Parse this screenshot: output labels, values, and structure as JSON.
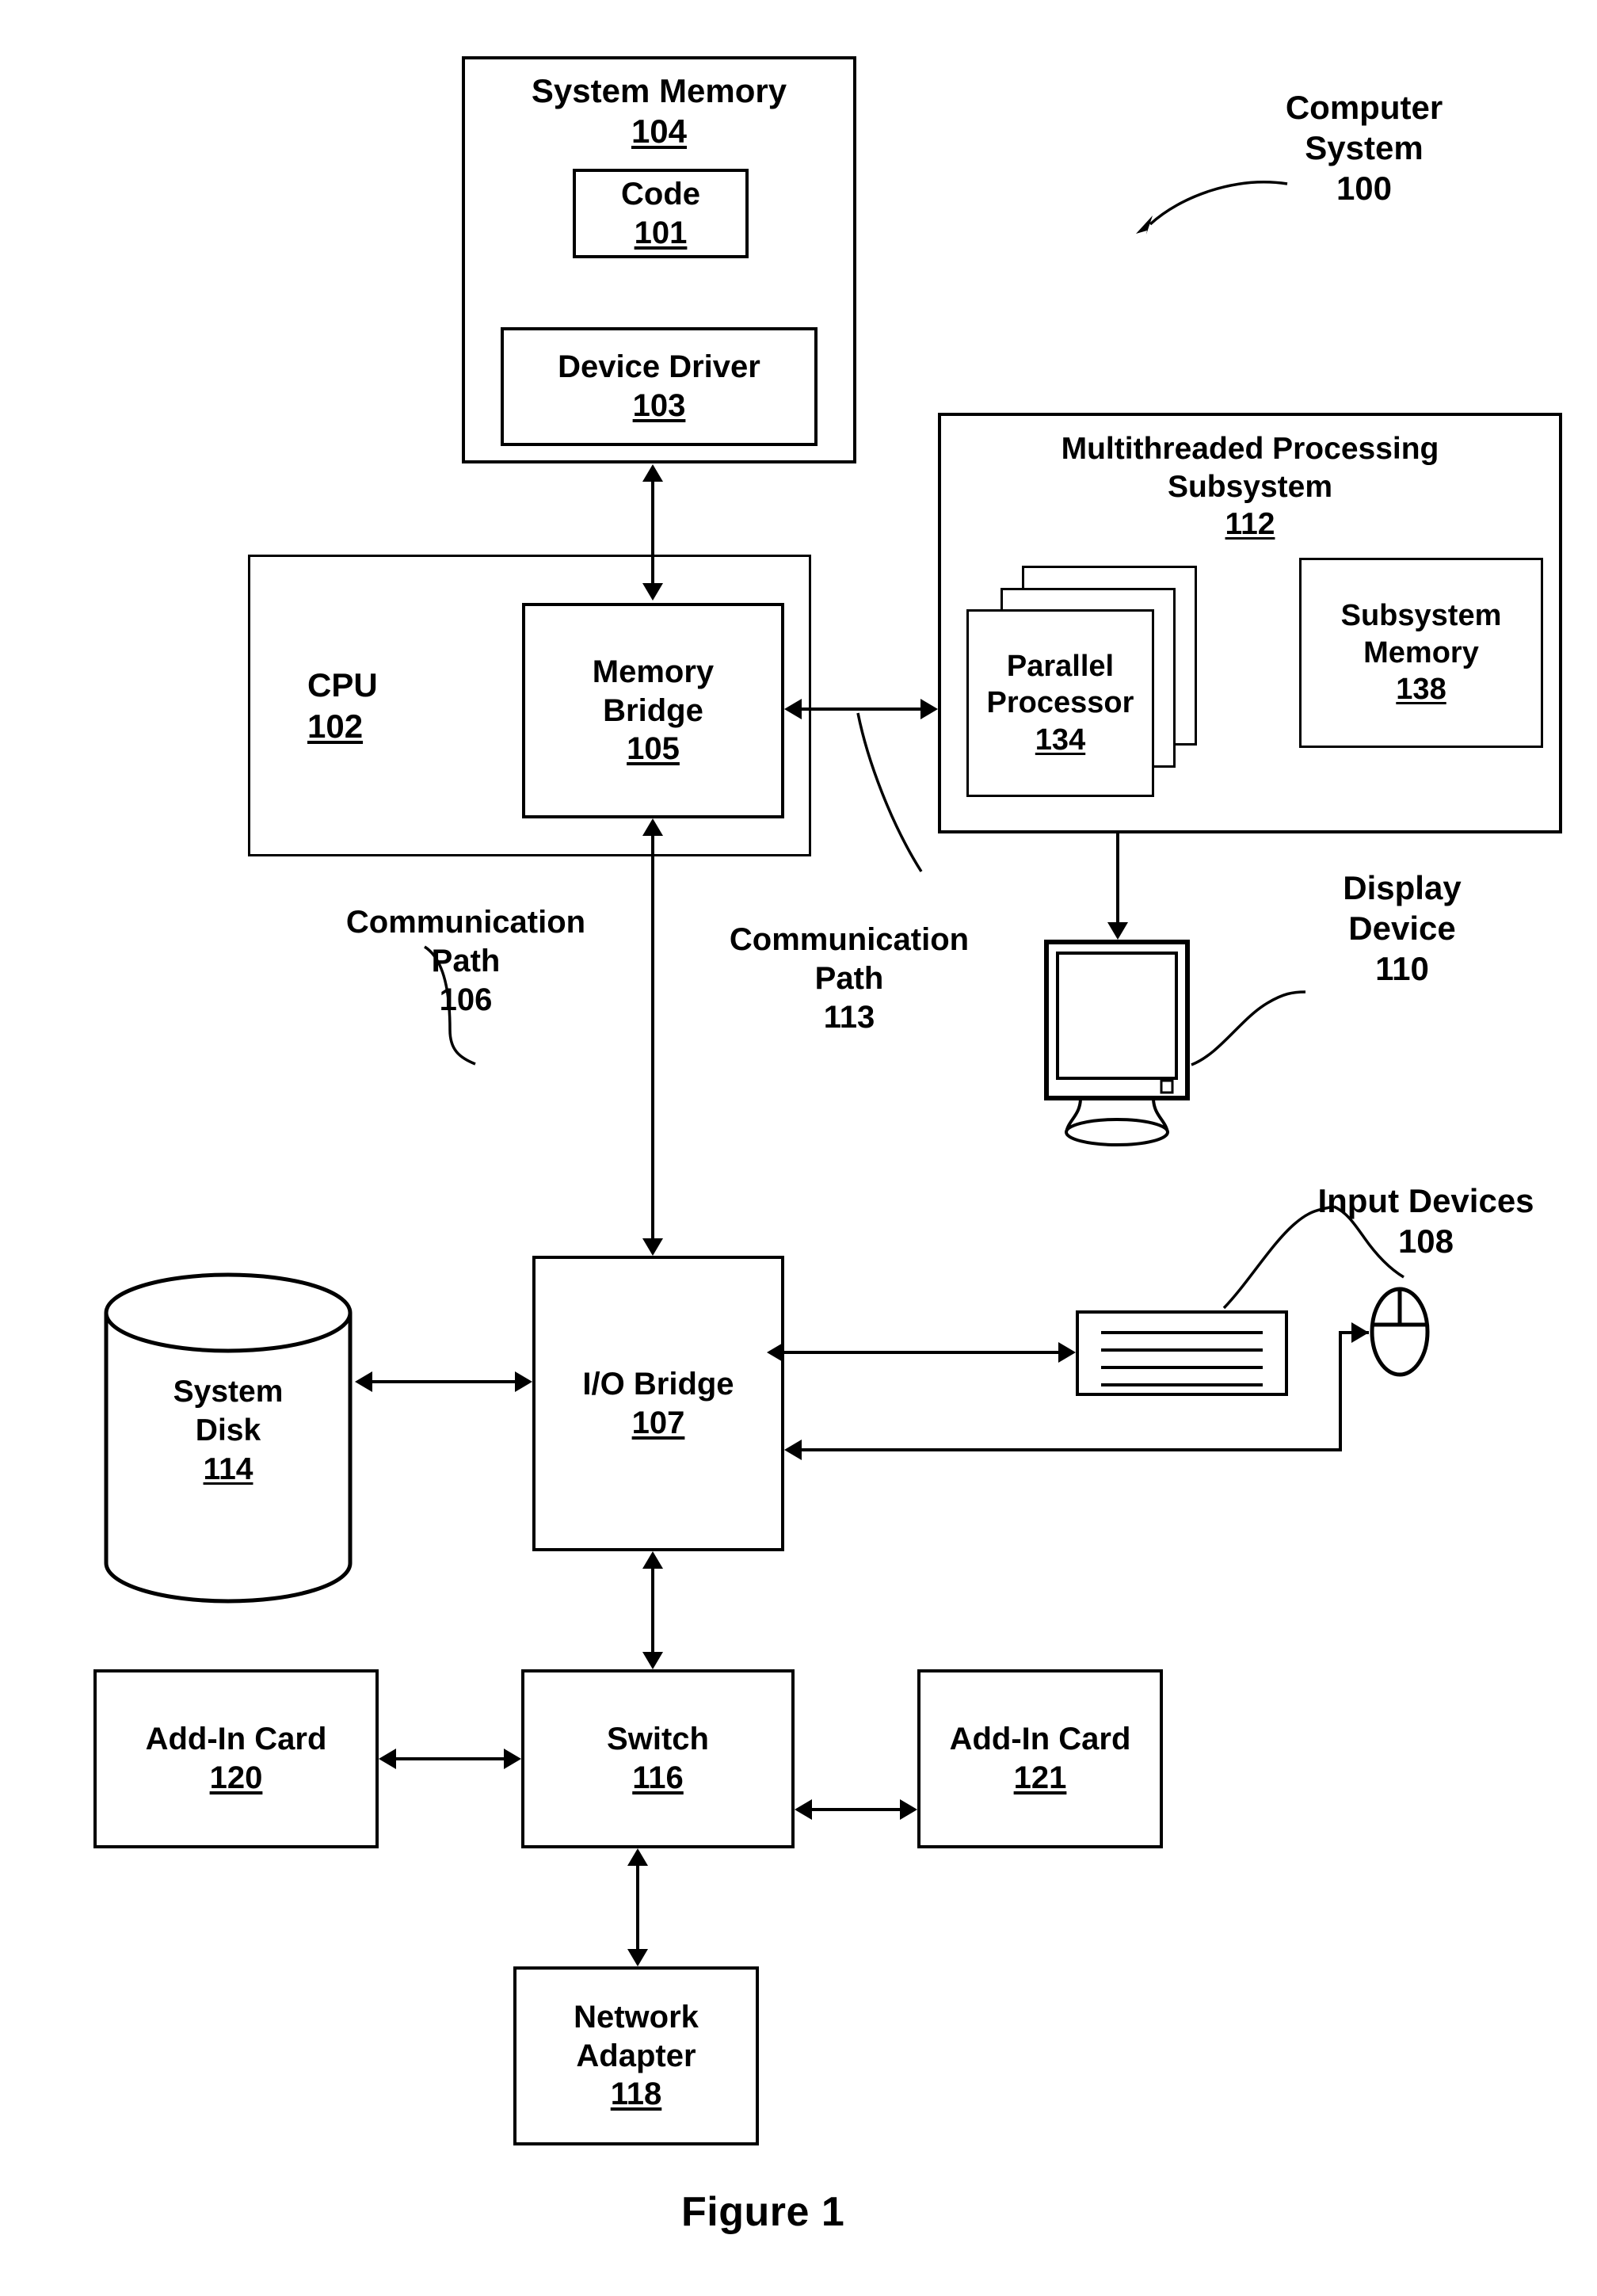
{
  "figure": {
    "caption": "Figure 1"
  },
  "callouts": {
    "computer_system": {
      "line1": "Computer",
      "line2": "System",
      "ref": "100"
    },
    "comm_path_106": {
      "line1": "Communication",
      "line2": "Path",
      "ref": "106"
    },
    "comm_path_113": {
      "line1": "Communication",
      "line2": "Path",
      "ref": "113"
    },
    "display_device": {
      "line1": "Display",
      "line2": "Device",
      "ref": "110"
    },
    "input_devices": {
      "line1": "Input Devices",
      "ref": "108"
    }
  },
  "blocks": {
    "system_memory": {
      "label": "System Memory",
      "ref": "104"
    },
    "code": {
      "label": "Code",
      "ref": "101"
    },
    "device_driver": {
      "label": "Device Driver",
      "ref": "103"
    },
    "cpu": {
      "label": "CPU",
      "ref": "102"
    },
    "memory_bridge": {
      "line1": "Memory",
      "line2": "Bridge",
      "ref": "105"
    },
    "multithreaded_subsystem": {
      "line1": "Multithreaded Processing",
      "line2": "Subsystem",
      "ref": "112"
    },
    "parallel_processor": {
      "line1": "Parallel",
      "line2": "Processor",
      "ref": "134"
    },
    "subsystem_memory": {
      "line1": "Subsystem",
      "line2": "Memory",
      "ref": "138"
    },
    "system_disk": {
      "line1": "System",
      "line2": "Disk",
      "ref": "114"
    },
    "io_bridge": {
      "label": "I/O Bridge",
      "ref": "107"
    },
    "switch": {
      "label": "Switch",
      "ref": "116"
    },
    "add_in_card_120": {
      "label": "Add-In Card",
      "ref": "120"
    },
    "add_in_card_121": {
      "label": "Add-In Card",
      "ref": "121"
    },
    "network_adapter": {
      "line1": "Network",
      "line2": "Adapter",
      "ref": "118"
    }
  },
  "icons": {
    "keyboard": "keyboard-icon",
    "mouse": "mouse-icon",
    "monitor": "monitor-icon",
    "disk": "cylinder-disk-icon"
  },
  "colors": {
    "ink": "#000000",
    "paper": "#ffffff"
  }
}
